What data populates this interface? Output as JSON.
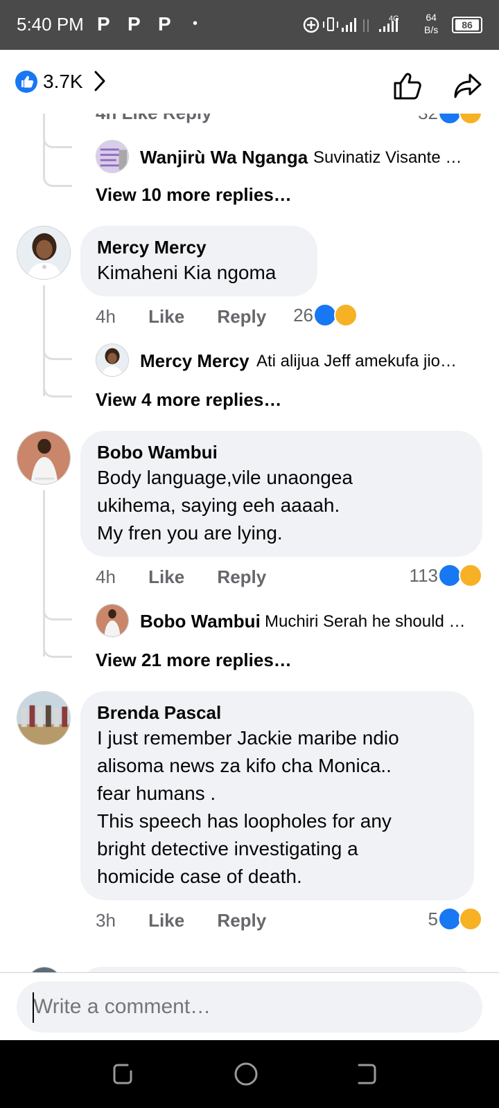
{
  "status_bar": {
    "time": "5:40 PM",
    "app_letters": [
      "P",
      "P",
      "P"
    ],
    "network": "4G",
    "speed_value": "64",
    "speed_unit": "B/s",
    "battery": "86"
  },
  "top_bar": {
    "reaction_count": "3.7K"
  },
  "comments": [
    {
      "name": "Mercy Mercy",
      "text": "Kimaheni Kia ngoma",
      "time": "4h",
      "like_label": "Like",
      "reply_label": "Reply",
      "reaction_count": "26",
      "preview_reply": {
        "name": "Mercy Mercy",
        "text": "Ati alijua Jeff amekufa jio…"
      },
      "view_more": "View 4 more replies…"
    },
    {
      "name": "Bobo Wambui",
      "text": "Body language,vile unaongea\nukihema, saying eeh aaaah.\nMy fren you are lying.",
      "time": "4h",
      "like_label": "Like",
      "reply_label": "Reply",
      "reaction_count": "113",
      "preview_reply": {
        "name": "Bobo Wambui",
        "text": "Muchiri Serah he should …"
      },
      "view_more": "View 21 more replies…"
    },
    {
      "name": "Brenda Pascal",
      "text": "I just remember Jackie maribe ndio\nalisoma news za kifo cha Monica..\nfear humans .\nThis speech has loopholes for any\nbright detective investigating a\nhomicide case of death.",
      "time": "3h",
      "like_label": "Like",
      "reply_label": "Reply",
      "reaction_count": "5"
    }
  ],
  "previous_thread": {
    "partial_actions": "4h   Like   Reply",
    "partial_count": "32",
    "preview_reply": {
      "name": "Wanjirù Wa Nganga",
      "text": "Suvinatiz Visante …"
    },
    "view_more": "View 10 more replies…"
  },
  "composer": {
    "placeholder": "Write a comment…"
  },
  "colors": {
    "accent": "#1877f2",
    "bubble": "#f0f2f5",
    "secondary_text": "#65676b",
    "haha": "#f7b125"
  },
  "icons": [
    "like-icon",
    "chevron-right-icon",
    "thumbs-up-icon",
    "share-icon",
    "haha-icon",
    "recents-icon",
    "home-icon",
    "back-icon"
  ]
}
